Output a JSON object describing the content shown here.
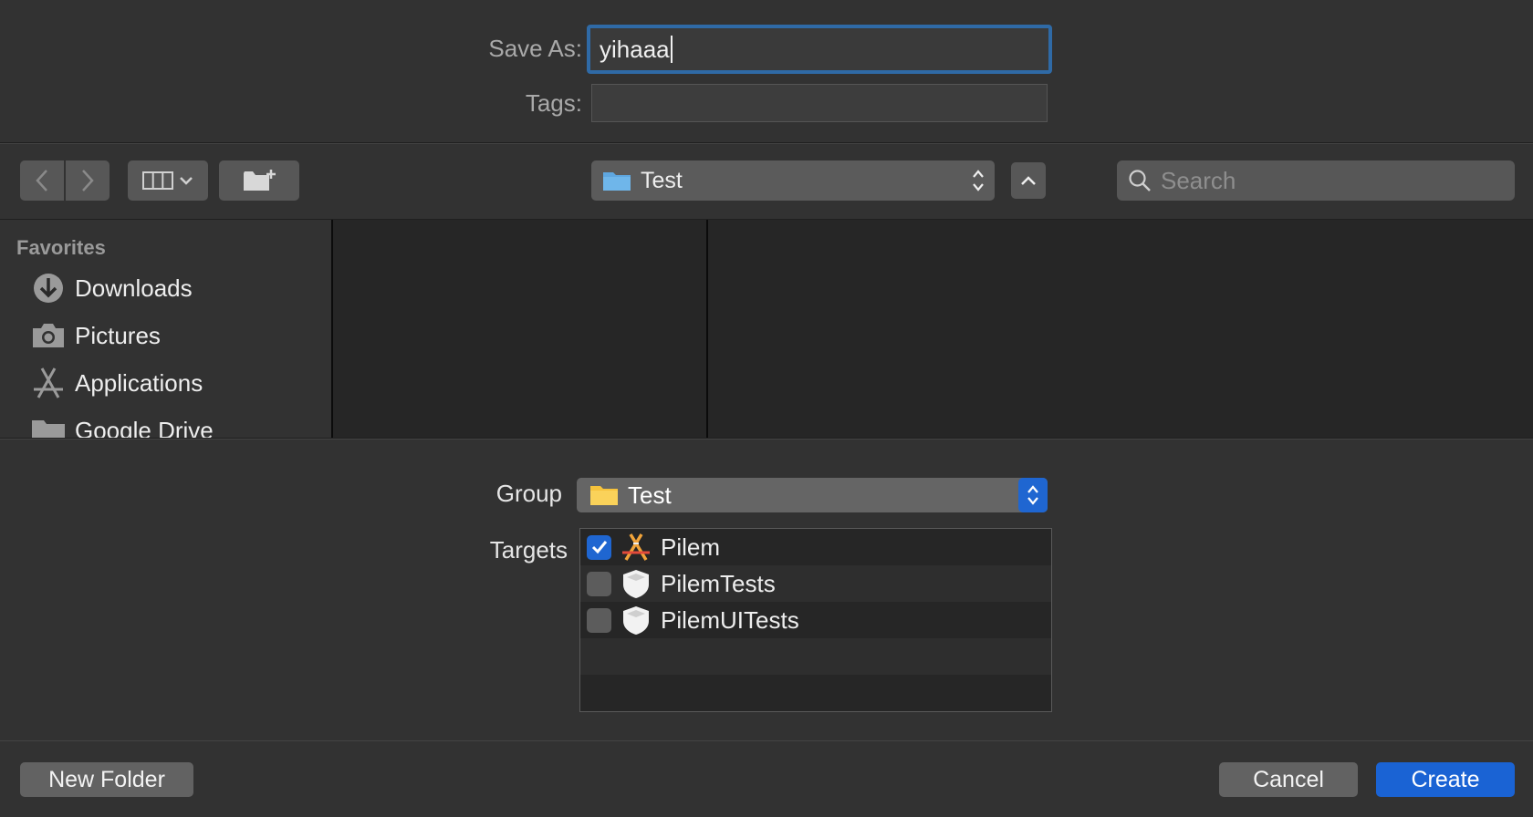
{
  "save_as": {
    "label": "Save As:",
    "value": "yihaaa"
  },
  "tags": {
    "label": "Tags:",
    "value": ""
  },
  "toolbar": {
    "location": "Test",
    "search_placeholder": "Search"
  },
  "sidebar": {
    "section_title": "Favorites",
    "items": [
      {
        "label": "Downloads",
        "icon": "download-icon"
      },
      {
        "label": "Pictures",
        "icon": "camera-icon"
      },
      {
        "label": "Applications",
        "icon": "applications-icon"
      },
      {
        "label": "Google Drive",
        "icon": "folder-icon"
      }
    ]
  },
  "options": {
    "group_label": "Group",
    "group_value": "Test",
    "targets_label": "Targets",
    "targets": [
      {
        "label": "Pilem",
        "checked": true,
        "icon": "app-target-icon"
      },
      {
        "label": "PilemTests",
        "checked": false,
        "icon": "test-target-icon"
      },
      {
        "label": "PilemUITests",
        "checked": false,
        "icon": "test-target-icon"
      }
    ]
  },
  "footer": {
    "new_folder": "New Folder",
    "cancel": "Cancel",
    "create": "Create"
  },
  "colors": {
    "background": "#323232",
    "accent": "#1a63d4",
    "focus_ring": "#2f6aa6"
  }
}
